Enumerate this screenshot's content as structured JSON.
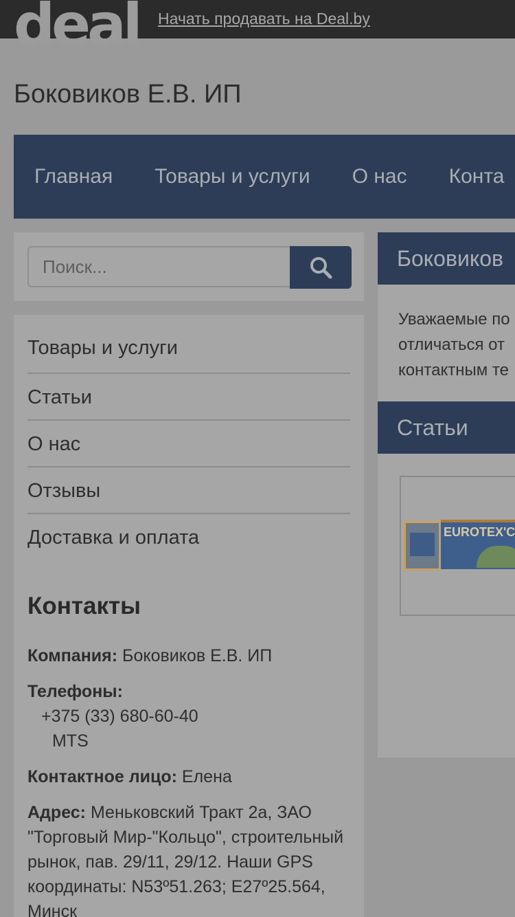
{
  "topbar": {
    "logo_text": "deal",
    "sell_link": "Начать продавать на Deal.by"
  },
  "company": {
    "title": "Боковиков Е.В. ИП"
  },
  "nav": {
    "items": [
      "Главная",
      "Товары и услуги",
      "О нас",
      "Конта"
    ]
  },
  "search": {
    "placeholder": "Поиск...",
    "icon": "search-icon"
  },
  "sidebar": {
    "menu": [
      "Товары и услуги",
      "Статьи",
      "О нас",
      "Отзывы",
      "Доставка и оплата"
    ]
  },
  "contacts": {
    "title": "Контакты",
    "company_label": "Компания:",
    "company_value": "Боковиков Е.В. ИП",
    "phones_label": "Телефоны:",
    "phone": "+375 (33) 680-60-40",
    "operator": "MTS",
    "person_label": "Контактное лицо:",
    "person_value": "Елена",
    "address_label": "Адрес:",
    "address_value": "Меньковский Тракт 2а, ЗАО \"Торговый Мир-\"Кольцо\", строительный рынок, пав. 29/11, 29/12. Наши GPS координаты: N53º51.263; E27º25.564, Минск"
  },
  "main": {
    "company_heading": "Боковиков",
    "notice_lines": [
      "Уважаемые по",
      "отличаться от",
      "контактным те"
    ],
    "articles_heading": "Статьи",
    "article_image_text": "EUROTEX'САУ"
  }
}
